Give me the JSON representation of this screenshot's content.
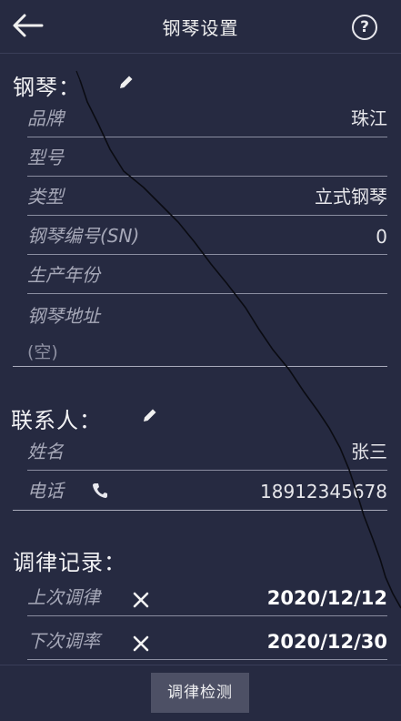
{
  "header": {
    "title": "钢琴设置",
    "help_label": "?"
  },
  "piano": {
    "section_title": "钢琴：",
    "rows": [
      {
        "label": "品牌",
        "value": "珠江"
      },
      {
        "label": "型号",
        "value": ""
      },
      {
        "label": "类型",
        "value": "立式钢琴"
      },
      {
        "label": "钢琴编号(SN)",
        "value": "0"
      },
      {
        "label": "生产年份",
        "value": ""
      },
      {
        "label": "钢琴地址",
        "value": "",
        "empty_text": "(空)"
      }
    ]
  },
  "contact": {
    "section_title": "联系人：",
    "name_label": "姓名",
    "name_value": "张三",
    "phone_label": "电话",
    "phone_value": "18912345678"
  },
  "tuning": {
    "section_title": "调律记录：",
    "last_label": "上次调律",
    "last_value": "2020/12/12",
    "next_label": "下次调率",
    "next_value": "2020/12/30"
  },
  "footer": {
    "detect_button": "调律检测"
  },
  "icons": {
    "back": "arrow-left-icon",
    "help": "question-circle-icon",
    "edit": "pencil-icon",
    "phone": "phone-icon",
    "clear": "x-icon"
  }
}
